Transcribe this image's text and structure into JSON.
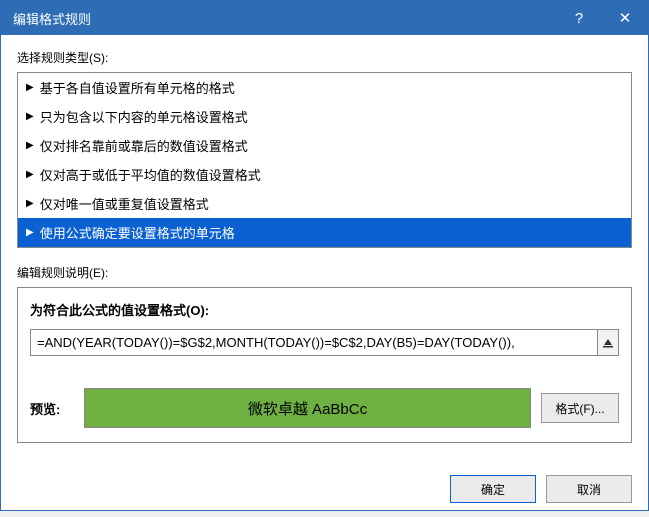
{
  "titlebar": {
    "title": "编辑格式规则",
    "help": "?",
    "close": "✕"
  },
  "ruleTypeLabel": "选择规则类型(S):",
  "ruleTypes": [
    "基于各自值设置所有单元格的格式",
    "只为包含以下内容的单元格设置格式",
    "仅对排名靠前或靠后的数值设置格式",
    "仅对高于或低于平均值的数值设置格式",
    "仅对唯一值或重复值设置格式",
    "使用公式确定要设置格式的单元格"
  ],
  "selectedRuleIndex": 5,
  "editLabel": "编辑规则说明(E):",
  "formulaLabel": "为符合此公式的值设置格式(O):",
  "formulaValue": "=AND(YEAR(TODAY())=$G$2,MONTH(TODAY())=$C$2,DAY(B5)=DAY(TODAY()),",
  "previewLabel": "预览:",
  "previewText": "微软卓越 AaBbCc",
  "previewBg": "#6fb043",
  "formatBtn": "格式(F)...",
  "footer": {
    "ok": "确定",
    "cancel": "取消"
  }
}
